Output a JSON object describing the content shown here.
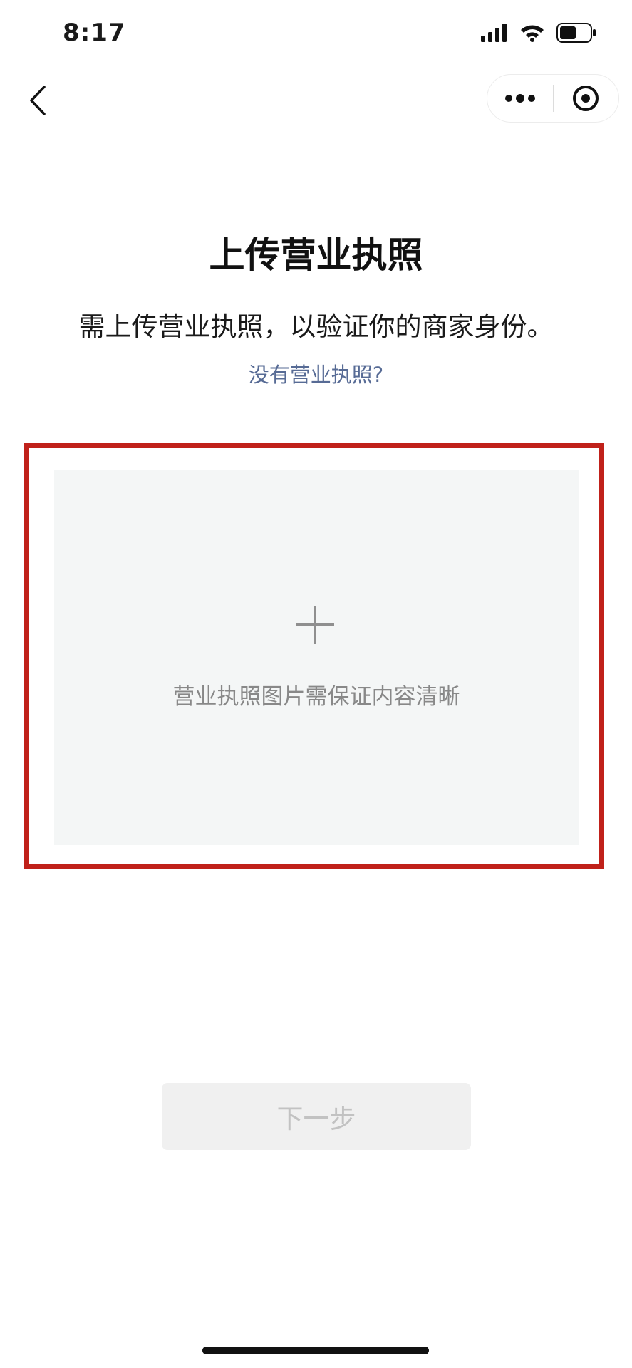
{
  "status_bar": {
    "time": "8:17",
    "icons": [
      "signal-icon",
      "wifi-icon",
      "battery-icon"
    ]
  },
  "nav": {
    "back_icon": "chevron-left-icon",
    "more_icon": "more-dots-icon",
    "close_icon": "record-target-icon"
  },
  "header": {
    "title": "上传营业执照",
    "description": "需上传营业执照，以验证你的商家身份。",
    "link_text": "没有营业执照?"
  },
  "upload": {
    "icon": "plus-icon",
    "hint": "营业执照图片需保证内容清晰"
  },
  "footer": {
    "next_label": "下一步"
  },
  "colors": {
    "link": "#576b95",
    "highlight_border": "#c0211a",
    "upload_bg": "#f4f6f6",
    "disabled_button_bg": "#f0f0f0",
    "disabled_button_text": "#c2c2c2"
  }
}
